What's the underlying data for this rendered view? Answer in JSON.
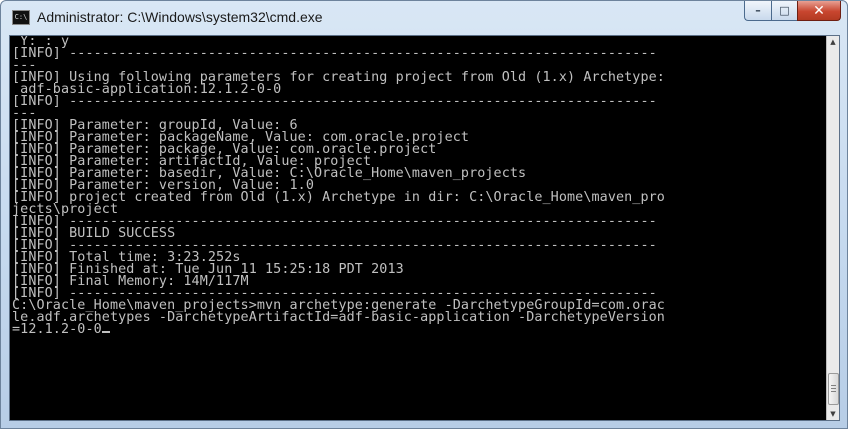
{
  "window": {
    "title": "Administrator: C:\\Windows\\system32\\cmd.exe",
    "app_icon_text": "C:\\",
    "minimize_glyph": "–",
    "maximize_glyph": "□",
    "close_glyph": "✕"
  },
  "console": {
    "lines": [
      " Y: : y",
      "[INFO] ------------------------------------------------------------------------",
      "---",
      "[INFO] Using following parameters for creating project from Old (1.x) Archetype:",
      " adf-basic-application:12.1.2-0-0",
      "[INFO] ------------------------------------------------------------------------",
      "---",
      "[INFO] Parameter: groupId, Value: 6",
      "[INFO] Parameter: packageName, Value: com.oracle.project",
      "[INFO] Parameter: package, Value: com.oracle.project",
      "[INFO] Parameter: artifactId, Value: project",
      "[INFO] Parameter: basedir, Value: C:\\Oracle_Home\\maven_projects",
      "[INFO] Parameter: version, Value: 1.0",
      "[INFO] project created from Old (1.x) Archetype in dir: C:\\Oracle_Home\\maven_pro",
      "jects\\project",
      "[INFO] ------------------------------------------------------------------------",
      "[INFO] BUILD SUCCESS",
      "[INFO] ------------------------------------------------------------------------",
      "[INFO] Total time: 3:23.252s",
      "[INFO] Finished at: Tue Jun 11 15:25:18 PDT 2013",
      "[INFO] Final Memory: 14M/117M",
      "[INFO] ------------------------------------------------------------------------",
      "C:\\Oracle_Home\\maven_projects>mvn archetype:generate -DarchetypeGroupId=com.orac",
      "le.adf.archetypes -DarchetypeArtifactId=adf-basic-application -DarchetypeVersion",
      "=12.1.2-0-0"
    ],
    "text_color": "#c0c0c0",
    "background_color": "#000000"
  }
}
